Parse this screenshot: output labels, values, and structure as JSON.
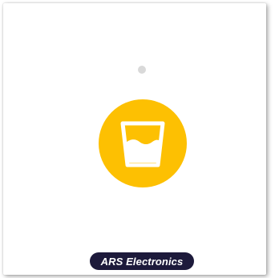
{
  "icon": "water-glass-icon",
  "brand": {
    "label": "ARS Electronics"
  },
  "colors": {
    "accent": "#fdc002",
    "badge": "#1d1a3b",
    "dot": "#d9d9d9"
  }
}
